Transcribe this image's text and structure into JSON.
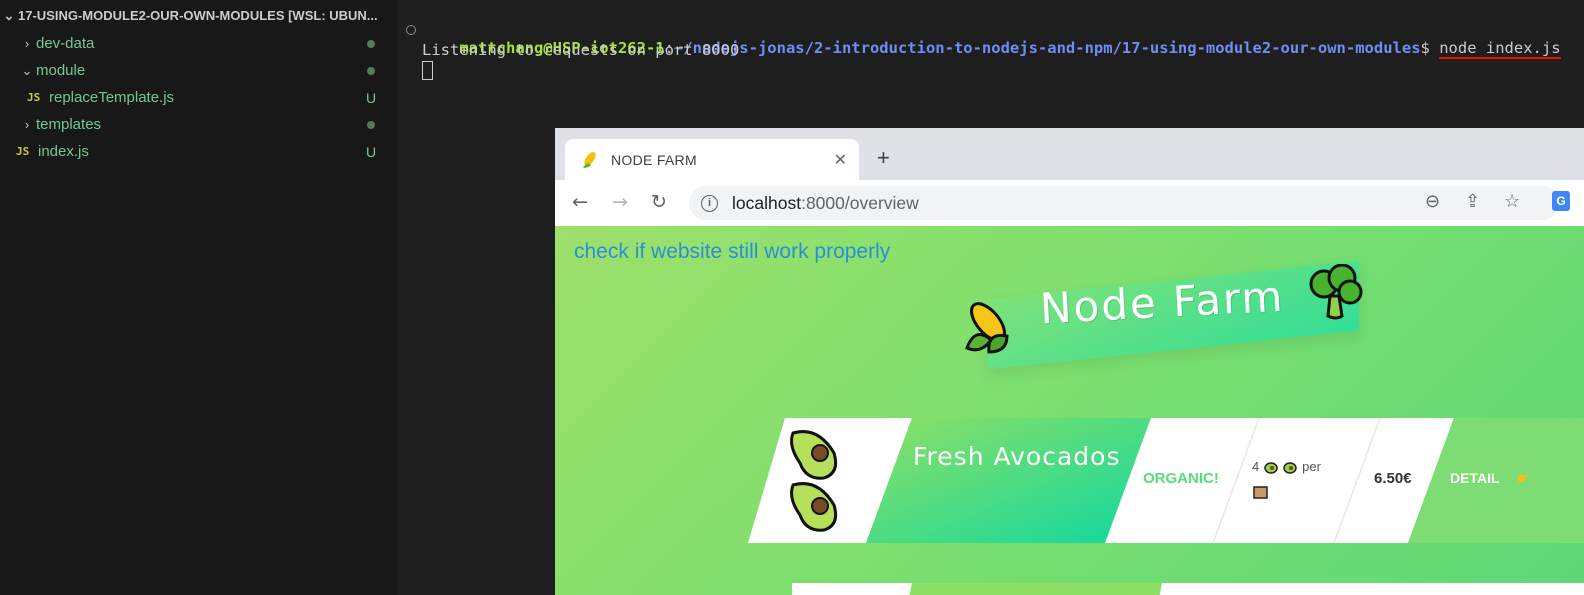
{
  "explorer": {
    "folder_title": "17-USING-MODULE2-OUR-OWN-MODULES [WSL: UBUN...",
    "items": [
      {
        "label": "dev-data",
        "kind": "folder",
        "expanded": false,
        "status": "dot"
      },
      {
        "label": "module",
        "kind": "folder",
        "expanded": true,
        "status": "dot"
      },
      {
        "label": "replaceTemplate.js",
        "kind": "file",
        "icon": "JS",
        "status": "U"
      },
      {
        "label": "templates",
        "kind": "folder",
        "expanded": false,
        "status": "dot"
      },
      {
        "label": "index.js",
        "kind": "file",
        "icon": "JS",
        "status": "U"
      }
    ]
  },
  "terminal": {
    "user_host": "mattchang@HSP-iot262-1",
    "separator": ":",
    "path": "~/nodejs-jonas/2-introduction-to-nodejs-and-npm/17-using-module2-our-own-modules",
    "prompt": "$",
    "command": "node index.js",
    "output": "Listening to requests on port 8000"
  },
  "browser": {
    "tab_title": "NODE FARM",
    "url_host": "localhost",
    "url_path": ":8000/overview",
    "ext_label": "G"
  },
  "page": {
    "note": "check if website still work properly",
    "site_title": "Node Farm",
    "product": {
      "name": "Fresh Avocados",
      "badge": "ORGANIC!",
      "quantity_prefix": "4",
      "quantity_text": "per",
      "price": "6.50€",
      "detail_label": "DETAIL"
    }
  },
  "colors": {
    "terminal_user": "#a6e22e",
    "terminal_path": "#6e8ef5",
    "explorer_text": "#73c991",
    "note_text": "#2b8fd8",
    "page_green": "#7ddf6e"
  }
}
